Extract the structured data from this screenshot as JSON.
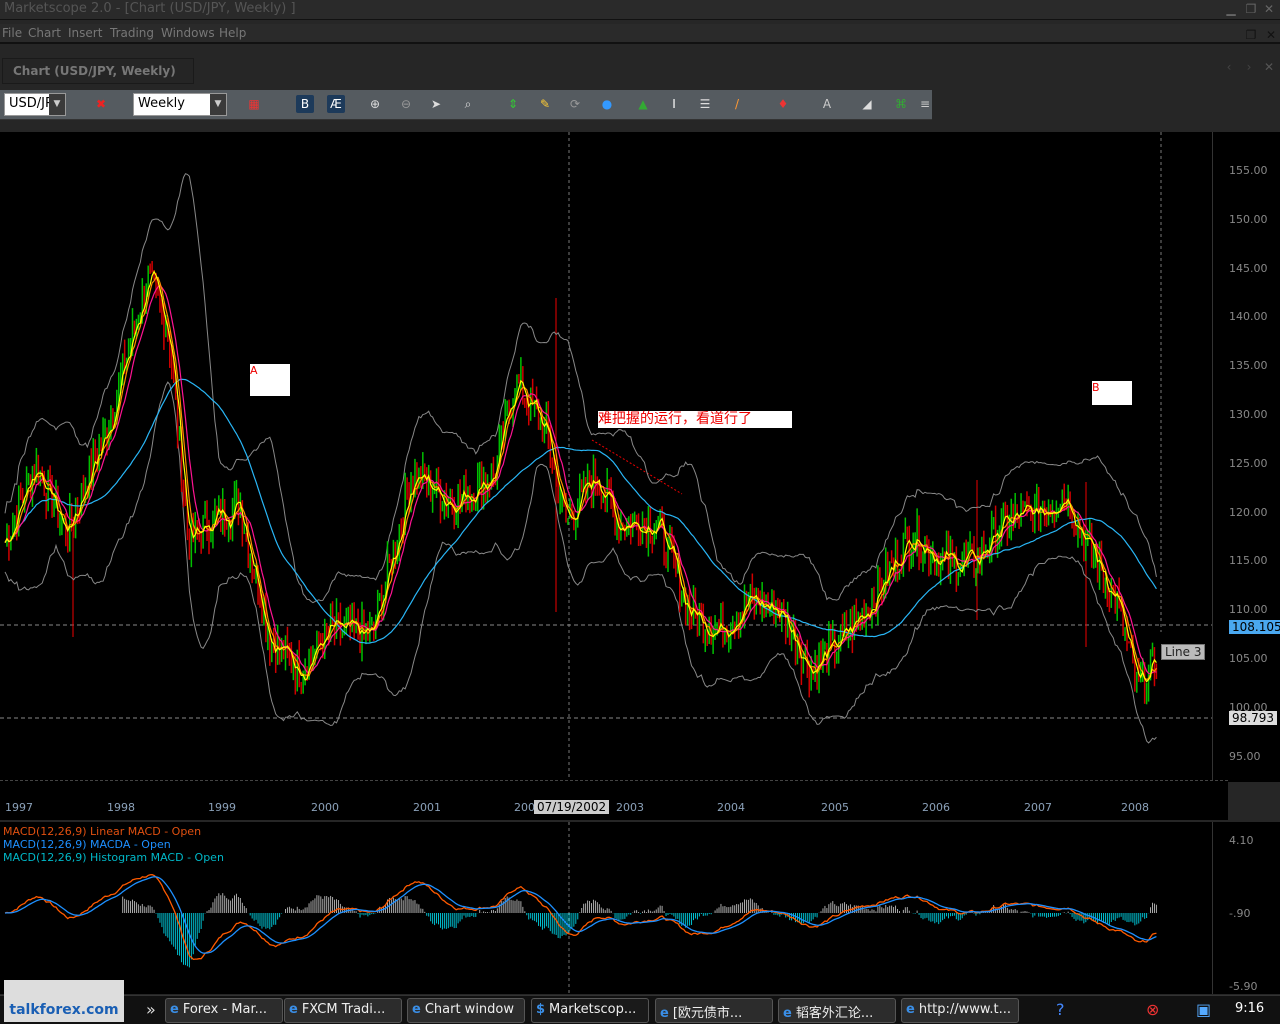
{
  "window": {
    "title": "Marketscope 2.0 - [Chart (USD/JPY, Weekly) ]"
  },
  "menu": [
    "File",
    "Chart",
    "Insert",
    "Trading",
    "Windows",
    "Help"
  ],
  "tab": {
    "label": "Chart (USD/JPY, Weekly)"
  },
  "toolbar": {
    "symbol": "USD/JPY",
    "period": "Weekly",
    "icons": [
      "chart-type-icon",
      "toggle-b-icon",
      "toggle-ae-icon",
      "zoom-in-icon",
      "zoom-out-icon",
      "cursor-icon",
      "zoom-area-icon",
      "crosshair-icon",
      "properties-icon",
      "refresh-icon",
      "globe-icon",
      "image-icon",
      "text-cursor-icon",
      "data-window-icon",
      "pencil-icon",
      "marker-icon",
      "text-label-icon",
      "eraser-icon",
      "network-icon",
      "more-icon"
    ]
  },
  "price_axis": {
    "ticks": [
      "155.00",
      "150.00",
      "145.00",
      "140.00",
      "135.00",
      "130.00",
      "125.00",
      "120.00",
      "115.00",
      "110.00",
      "105.00",
      "100.00",
      "95.00"
    ],
    "current": "108.105",
    "cursor_price": "98.793",
    "line_label": "Line 3"
  },
  "date_axis": {
    "ticks": [
      "1997",
      "1998",
      "1999",
      "2000",
      "2001",
      "2002",
      "2003",
      "2004",
      "2005",
      "2006",
      "2007",
      "2008"
    ],
    "cursor_date": "07/19/2002"
  },
  "annotations": {
    "a": "A",
    "b": "B",
    "comment": "难把握的运行，看道行了"
  },
  "macd": {
    "legend": [
      "MACD(12,26,9) Linear MACD - Open",
      "MACD(12,26,9) MACDA - Open",
      "MACD(12,26,9) Histogram MACD - Open"
    ],
    "ticks": [
      "4.10",
      "-.90",
      "-5.90"
    ]
  },
  "colors": {
    "up": "#00c000",
    "down": "#d00000",
    "ma_fast": "#ffff00",
    "ma_mid": "#ff8c00",
    "ma_slow": "#ff1493",
    "ma_long": "#29b6f6",
    "bands": "#888888",
    "macd": "#ff5a00",
    "signal": "#1e90ff",
    "hist": "#00c0d0",
    "current_price": "#4aa8f0"
  },
  "chart_data": {
    "type": "candlestick",
    "symbol": "USD/JPY",
    "period": "Weekly",
    "ylim": [
      92,
      158
    ],
    "macd_ylim": [
      -5.9,
      4.1
    ],
    "x": [
      1997.0,
      1997.3,
      1997.6,
      1998.0,
      1998.4,
      1998.6,
      1998.8,
      1999.0,
      1999.3,
      1999.6,
      1999.9,
      2000.2,
      2000.6,
      2001.0,
      2001.4,
      2001.8,
      2002.0,
      2002.3,
      2002.5,
      2002.8,
      2003.0,
      2003.4,
      2003.7,
      2004.0,
      2004.3,
      2004.6,
      2004.9,
      2005.2,
      2005.5,
      2005.9,
      2006.2,
      2006.5,
      2006.8,
      2007.1,
      2007.4,
      2007.6,
      2007.9,
      2008.1,
      2008.3
    ],
    "y": [
      117,
      125,
      118,
      128.5,
      144,
      139,
      117,
      119,
      121,
      107,
      104,
      108,
      107.5,
      124,
      121,
      124,
      133.6,
      128.5,
      119,
      124,
      119,
      119,
      110,
      108,
      111,
      110,
      104,
      107,
      111,
      118,
      115,
      115,
      119,
      120,
      122,
      117,
      111,
      102,
      105
    ]
  },
  "taskbar": {
    "logo": "talkforex.com",
    "items": [
      "Forex - Mar...",
      "FXCM Tradi...",
      "Chart window",
      "Marketscop...",
      "[欧元债市...",
      "韬客外汇论...",
      "http://www.t..."
    ],
    "clock": "9:16"
  }
}
